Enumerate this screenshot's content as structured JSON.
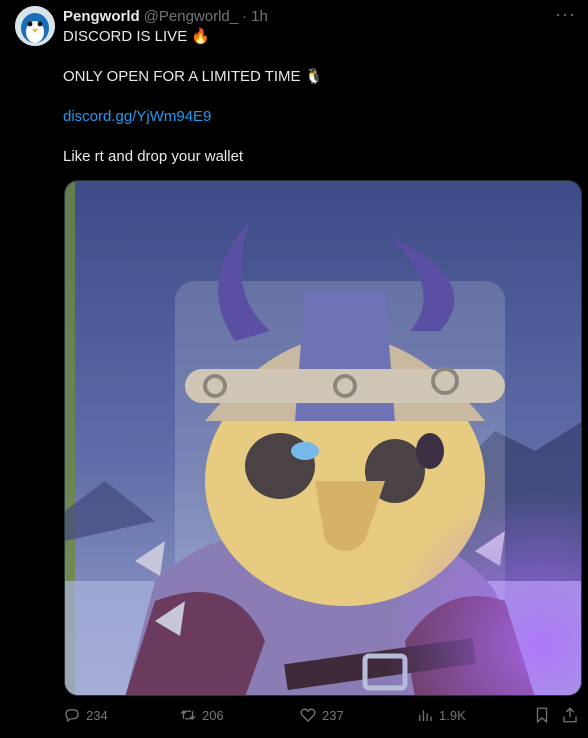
{
  "author": {
    "name": "Pengworld",
    "handle": "@Pengworld_",
    "separator": "·",
    "time": "1h",
    "more_label": "···"
  },
  "post": {
    "line1": "DISCORD IS LIVE",
    "line1_emoji": "🔥",
    "line2": "ONLY OPEN FOR A LIMITED TIME",
    "line2_emoji": "🐧",
    "link": "discord.gg/YjWm94E9",
    "line4": "Like rt and drop your wallet"
  },
  "actions": {
    "replies": "234",
    "reposts": "206",
    "likes": "237",
    "views": "1.9K"
  },
  "colors": {
    "link": "#1d9bf0",
    "muted": "#71767b",
    "text": "#e7e9ea",
    "background": "#000000"
  }
}
